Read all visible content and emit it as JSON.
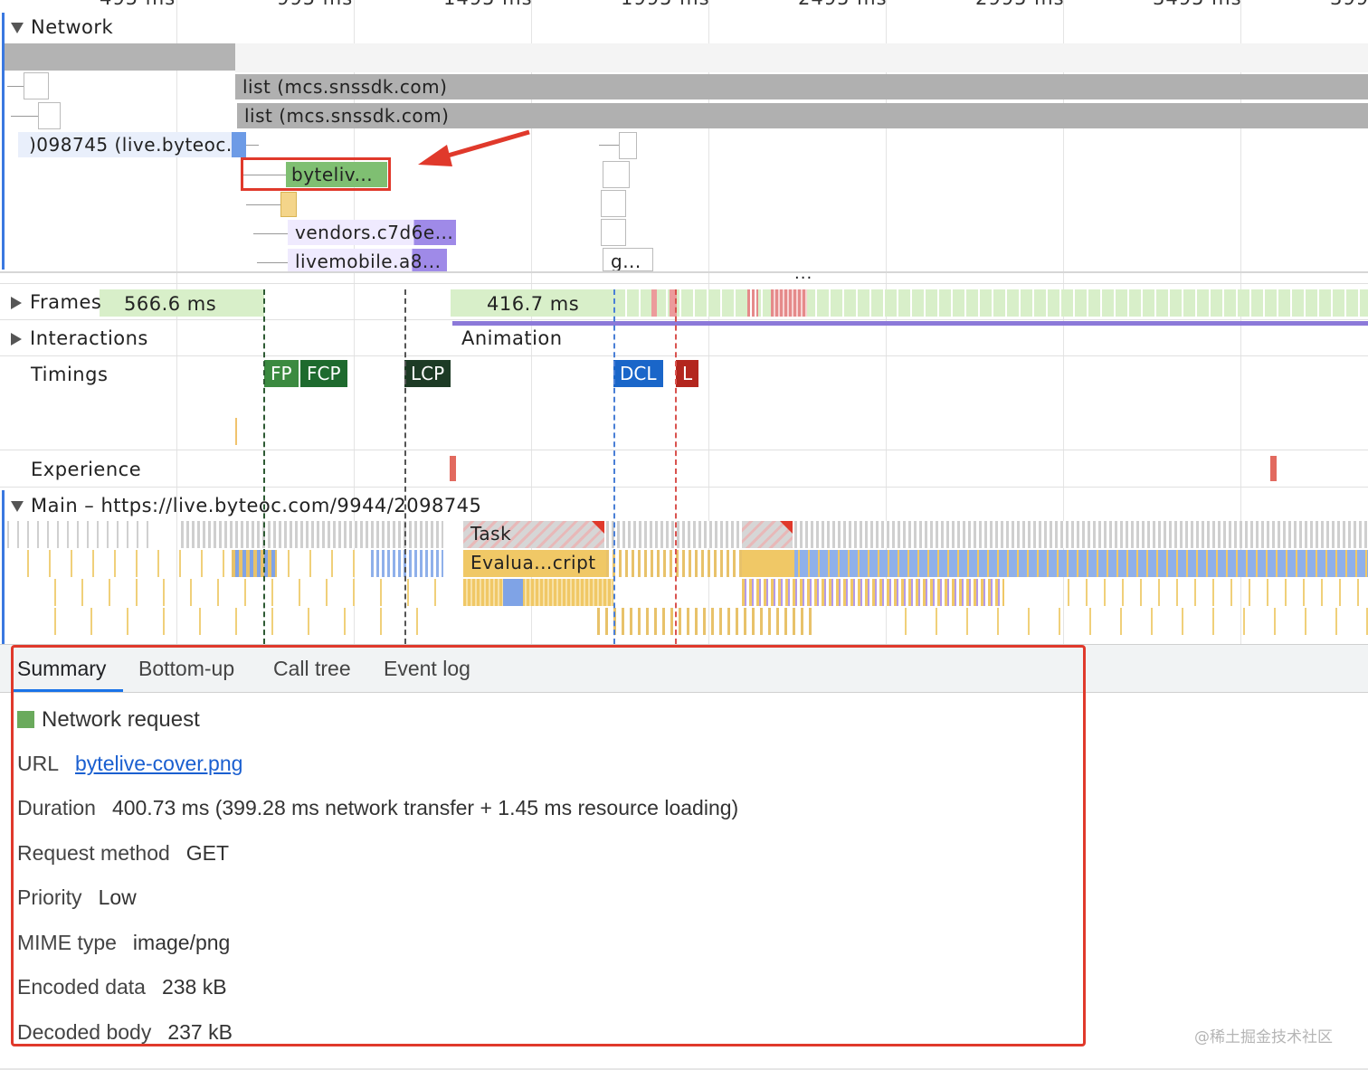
{
  "ruler": {
    "ticks": [
      "495 ms",
      "995 ms",
      "1495 ms",
      "1995 ms",
      "2495 ms",
      "2995 ms",
      "3495 ms",
      "399"
    ]
  },
  "network": {
    "label": "Network",
    "requests": {
      "list1": "list (mcs.snssdk.com)",
      "list2": "list (mcs.snssdk.com)",
      "doc": ")098745 (live.byteoc.c...",
      "cover": "byteliv...",
      "vendors": "vendors.c7d6e...",
      "livemobile": "livemobile.a8...",
      "g": "g..."
    },
    "more": "..."
  },
  "tracks": {
    "frames": {
      "label": "Frames",
      "v1": "566.6 ms",
      "v2": "416.7 ms"
    },
    "interactions": {
      "label": "Interactions",
      "animation": "Animation"
    },
    "timings": {
      "label": "Timings",
      "fp": "FP",
      "fcp": "FCP",
      "lcp": "LCP",
      "dcl": "DCL",
      "l": "L"
    },
    "experience": {
      "label": "Experience"
    },
    "main": {
      "label": "Main – https://live.byteoc.com/9944/2098745",
      "task": "Task",
      "evaluate": "Evalua...cript"
    }
  },
  "tabs": [
    "Summary",
    "Bottom-up",
    "Call tree",
    "Event log"
  ],
  "summary": {
    "title": "Network request",
    "url_label": "URL",
    "url": "bytelive-cover.png",
    "duration_label": "Duration",
    "duration": "400.73 ms (399.28 ms network transfer + 1.45 ms resource loading)",
    "method_label": "Request method",
    "method": "GET",
    "priority_label": "Priority",
    "priority": "Low",
    "mime_label": "MIME type",
    "mime": "image/png",
    "encoded_label": "Encoded data",
    "encoded": "238 kB",
    "decoded_label": "Decoded body",
    "decoded": "237 kB"
  },
  "watermark": "@稀土掘金技术社区",
  "colors": {
    "highlight": "#e0392b",
    "link": "#1a5fd0",
    "network_img": "#6aaa5c",
    "script": "#9f8ae8"
  }
}
